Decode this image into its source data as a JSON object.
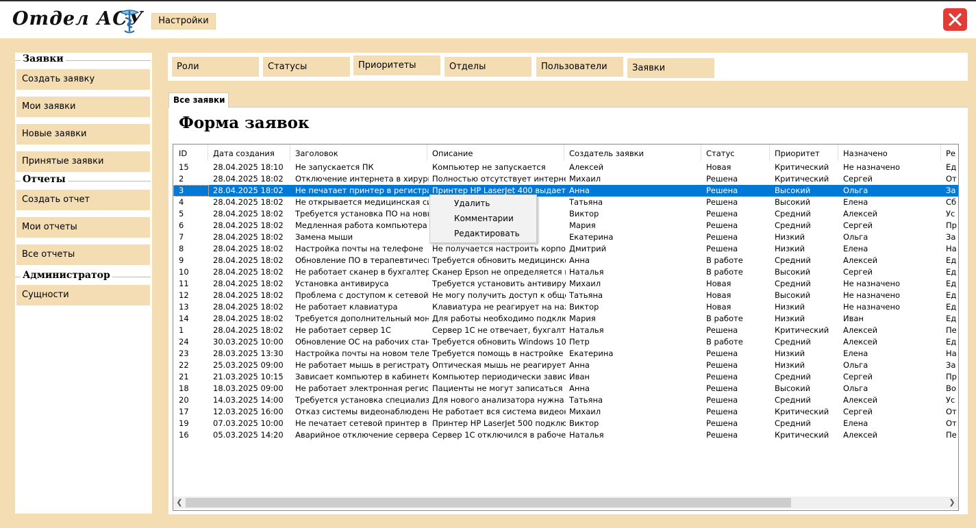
{
  "app": {
    "title": "Отдел АСУ",
    "settings_label": "Настройки"
  },
  "sidebar": {
    "sections": [
      {
        "title": "Заявки",
        "items": [
          "Создать заявку",
          "Мои заявки",
          "Новые заявки",
          "Принятые заявки"
        ]
      },
      {
        "title": "Отчеты",
        "items": [
          "Создать отчет",
          "Мои отчеты",
          "Все отчеты"
        ]
      },
      {
        "title": "Администратор",
        "items": [
          "Сущности"
        ]
      }
    ]
  },
  "top_tabs": [
    "Роли",
    "Статусы",
    "Приоритеты",
    "Отделы",
    "Пользователи",
    "Заявки"
  ],
  "inner_tab": "Все заявки",
  "form_title": "Форма заявок",
  "grid": {
    "columns": [
      "ID",
      "Дата создания",
      "Заголовок",
      "Описание",
      "Создатель заявки",
      "Статус",
      "Приоритет",
      "Назначено",
      "Ре"
    ],
    "selected_row": 2,
    "rows": [
      [
        "15",
        "28.04.2025 18:10",
        "Не запускается ПК",
        "Компьютер не запускается",
        "Алексей",
        "Новая",
        "Критический",
        "Не назначено",
        "Ед"
      ],
      [
        "2",
        "28.04.2025 18:02",
        "Отключение интернета в хирургии",
        "Полностью отсутствует интернет в…",
        "Михаил",
        "Решена",
        "Критический",
        "Сергей",
        "От"
      ],
      [
        "3",
        "28.04.2025 18:02",
        "Не печатает принтер в регистратуре",
        "Принтер HP LaserJet 400 выдает о…",
        "Анна",
        "Решена",
        "Высокий",
        "Ольга",
        "За"
      ],
      [
        "4",
        "28.04.2025 18:02",
        "Не открывается медицинская сис…",
        "…ает о…",
        "Татьяна",
        "Решена",
        "Высокий",
        "Елена",
        "Сб"
      ],
      [
        "5",
        "28.04.2025 18:02",
        "Требуется установка ПО на новый…",
        "…й к…",
        "Виктор",
        "Решена",
        "Средний",
        "Алексей",
        "Ус"
      ],
      [
        "6",
        "28.04.2025 18:02",
        "Медленная работа компьютера",
        "…бота…",
        "Мария",
        "Решена",
        "Средний",
        "Сергей",
        "Пр"
      ],
      [
        "7",
        "28.04.2025 18:02",
        "Замена мыши",
        "…мышь в…",
        "Екатерина",
        "Решена",
        "Низкий",
        "Ольга",
        "За"
      ],
      [
        "8",
        "28.04.2025 18:02",
        "Настройка почты на телефоне",
        "Не получается настроить корпорат…",
        "Дмитрий",
        "Решена",
        "Низкий",
        "Елена",
        "На"
      ],
      [
        "9",
        "28.04.2025 18:02",
        "Обновление ПО в терапевтическо…",
        "Требуется обновить медицинское …",
        "Анна",
        "В работе",
        "Средний",
        "Алексей",
        "Ед"
      ],
      [
        "10",
        "28.04.2025 18:02",
        "Не работает сканер в бухгалтерии",
        "Сканер Epson не определяется ко…",
        "Наталья",
        "В работе",
        "Высокий",
        "Сергей",
        "Ед"
      ],
      [
        "11",
        "28.04.2025 18:02",
        "Установка антивируса",
        "Требуется установить антивирус н…",
        "Михаил",
        "Новая",
        "Средний",
        "Не назначено",
        "Ед"
      ],
      [
        "12",
        "28.04.2025 18:02",
        "Проблема с доступом к сетевой п…",
        "Не могу получить доступ к общей …",
        "Татьяна",
        "Новая",
        "Высокий",
        "Не назначено",
        "Ед"
      ],
      [
        "13",
        "28.04.2025 18:02",
        "Не работает клавиатура",
        "Клавиатура не реагирует на нажат…",
        "Виктор",
        "Новая",
        "Низкий",
        "Не назначено",
        "Ед"
      ],
      [
        "14",
        "28.04.2025 18:02",
        "Требуется дополнительный монитор",
        "Для работы необходимо подключ…",
        "Мария",
        "В работе",
        "Низкий",
        "Иван",
        "Ед"
      ],
      [
        "1",
        "28.04.2025 18:02",
        "Не работает сервер 1С",
        "Сервер 1С не отвечает, бухгалтери…",
        "Наталья",
        "Решена",
        "Критический",
        "Алексей",
        "Пе"
      ],
      [
        "24",
        "30.03.2025 10:00",
        "Обновление ОС на рабочих станциях",
        "Требуется обновить Windows 10 д…",
        "Петр",
        "В работе",
        "Средний",
        "Алексей",
        "Ед"
      ],
      [
        "23",
        "28.03.2025 13:30",
        "Настройка почты на новом телефо…",
        "Требуется помощь в настройке ко…",
        "Екатерина",
        "Решена",
        "Низкий",
        "Елена",
        "На"
      ],
      [
        "22",
        "25.03.2025 09:00",
        "Не работает мышь в регистратуре",
        "Оптическая мышь не реагирует на…",
        "Анна",
        "Решена",
        "Низкий",
        "Ольга",
        "За"
      ],
      [
        "21",
        "21.03.2025 10:15",
        "Зависает компьютер в кабинете г…",
        "Компьютер периодически зависае…",
        "Иван",
        "Решена",
        "Средний",
        "Сергей",
        "Пр"
      ],
      [
        "18",
        "18.03.2025 09:00",
        "Не работает электронная регистр…",
        "Пациенты не могут записаться на …",
        "Анна",
        "Решена",
        "Высокий",
        "Ольга",
        "Во"
      ],
      [
        "20",
        "14.03.2025 14:00",
        "Требуется установка специализир…",
        "Для нового анализатора нужна ус…",
        "Татьяна",
        "Решена",
        "Средний",
        "Алексей",
        "Ус"
      ],
      [
        "17",
        "12.03.2025 16:00",
        "Отказ системы видеонаблюдения",
        "Не работает вся система видеона…",
        "Михаил",
        "Решена",
        "Критический",
        "Сергей",
        "От"
      ],
      [
        "19",
        "07.03.2025 10:00",
        "Не печатает сетевой принтер в ла…",
        "Принтер HP LaserJet 500 подключе…",
        "Виктор",
        "Решена",
        "Средний",
        "Елена",
        "От"
      ],
      [
        "16",
        "05.03.2025 14:20",
        "Аварийное отключение сервера 1С",
        "Сервер 1С отключился в рабочее в…",
        "Наталья",
        "Решена",
        "Критический",
        "Алексей",
        "Пе"
      ]
    ]
  },
  "context_menu": [
    "Удалить",
    "Комментарии",
    "Редактировать"
  ],
  "colors": {
    "background": "#f4ddb3",
    "selection": "#0078d7",
    "close": "#e33b35"
  },
  "icons": {
    "logo": "caduceus-bowl-icon",
    "close": "close-icon"
  }
}
